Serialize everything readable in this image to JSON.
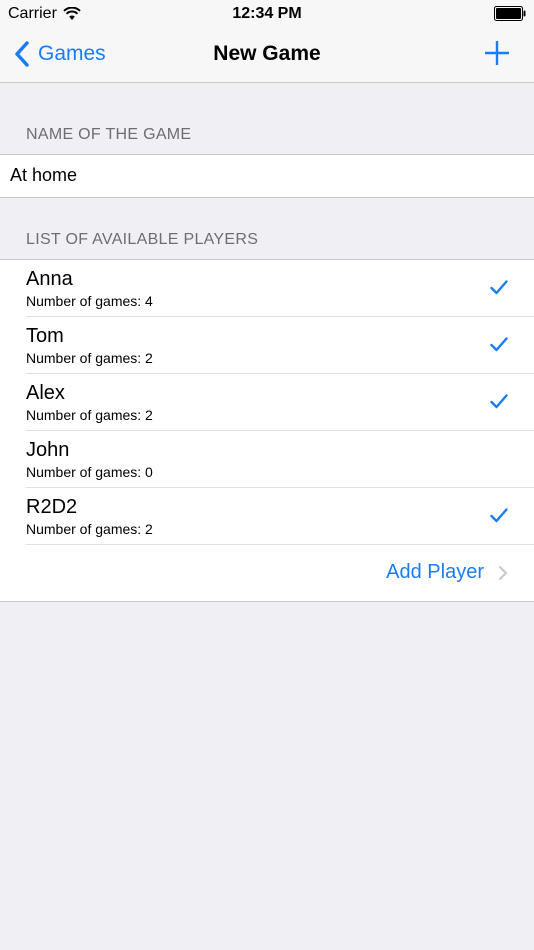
{
  "status_bar": {
    "carrier": "Carrier",
    "time": "12:34 PM"
  },
  "nav": {
    "back_label": "Games",
    "title": "New Game"
  },
  "game_name": {
    "header": "NAME OF THE GAME",
    "value": "At home"
  },
  "players": {
    "header": "LIST OF AVAILABLE PLAYERS",
    "items": [
      {
        "name": "Anna",
        "games": "Number of games: 4",
        "selected": true
      },
      {
        "name": "Tom",
        "games": "Number of games: 2",
        "selected": true
      },
      {
        "name": "Alex",
        "games": "Number of games: 2",
        "selected": true
      },
      {
        "name": "John",
        "games": "Number of games: 0",
        "selected": false
      },
      {
        "name": "R2D2",
        "games": "Number of games: 2",
        "selected": true
      }
    ],
    "add_label": "Add Player"
  },
  "colors": {
    "accent": "#1a7cf4",
    "background": "#efeff4",
    "separator": "#c8c7cc"
  }
}
